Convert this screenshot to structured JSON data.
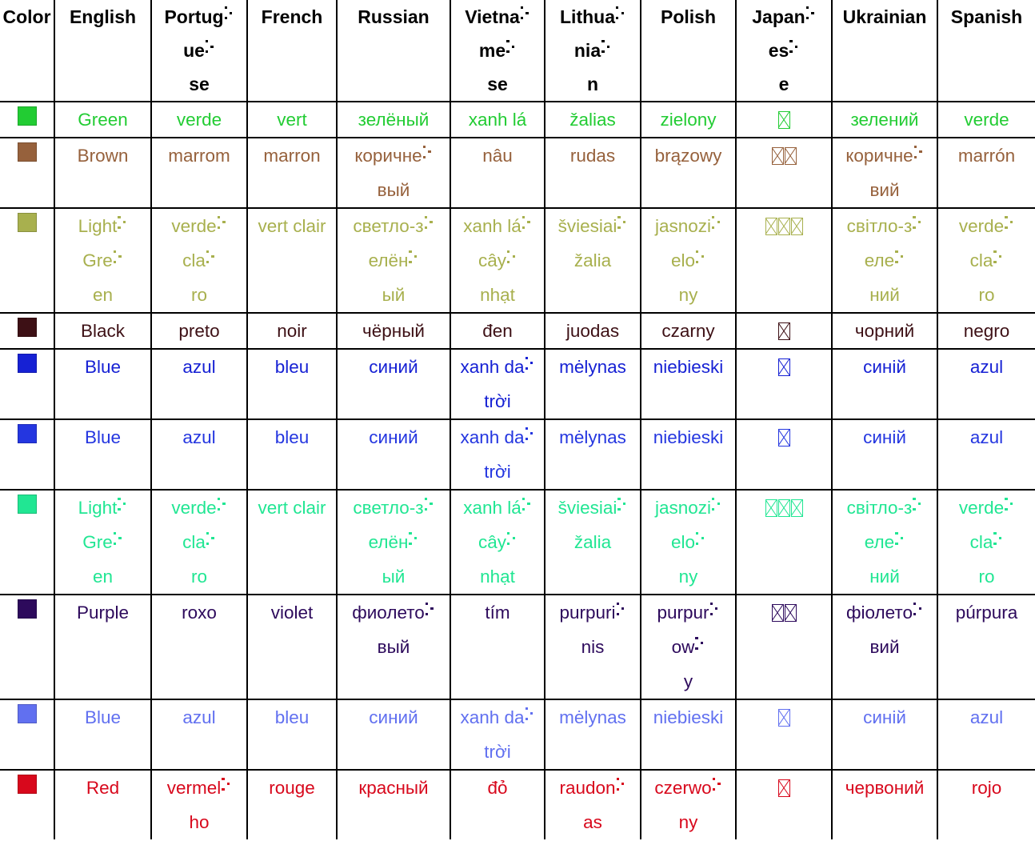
{
  "table": {
    "columns": [
      {
        "key": "color",
        "label": "Color"
      },
      {
        "key": "english",
        "label": "English"
      },
      {
        "key": "portuguese",
        "label": "Portuguese"
      },
      {
        "key": "french",
        "label": "French"
      },
      {
        "key": "russian",
        "label": "Russian"
      },
      {
        "key": "vietnamese",
        "label": "Vietnamese"
      },
      {
        "key": "lithuanian",
        "label": "Lithuanian"
      },
      {
        "key": "polish",
        "label": "Polish"
      },
      {
        "key": "japanese",
        "label": "Japanese"
      },
      {
        "key": "ukrainian",
        "label": "Ukrainian"
      },
      {
        "key": "spanish",
        "label": "Spanish"
      }
    ],
    "rows": [
      {
        "swatch": "#22cc33",
        "text_color": "#22cc33",
        "english": "Green",
        "portuguese": "verde",
        "french": "vert",
        "russian": "зелёный",
        "vietnamese": "xanh lá",
        "lithuanian": "žalias",
        "polish": "zielony",
        "japanese": "緑",
        "japanese_tofu": 1,
        "ukrainian": "зелений",
        "spanish": "verde"
      },
      {
        "swatch": "#96613c",
        "text_color": "#96613c",
        "english": "Brown",
        "portuguese": "marrom",
        "french": "marron",
        "russian": "коричневый",
        "vietnamese": "nâu",
        "lithuanian": "rudas",
        "polish": "brązowy",
        "japanese": "茶色",
        "japanese_tofu": 2,
        "ukrainian": "коричневий",
        "spanish": "marrón"
      },
      {
        "swatch": "#a8b04e",
        "text_color": "#a8b04e",
        "english": "Light Green",
        "portuguese": "verde claro",
        "french": "vert clair",
        "russian": "светло-зелёный",
        "vietnamese": "xanh lá cây nhạt",
        "lithuanian": "šviesiai žalia",
        "polish": "jasnozielony",
        "japanese": "明るい緑",
        "japanese_tofu": 3,
        "ukrainian": "світло-зелений",
        "spanish": "verde claro"
      },
      {
        "swatch": "#3d1015",
        "text_color": "#3d1015",
        "english": "Black",
        "portuguese": "preto",
        "french": "noir",
        "russian": "чёрный",
        "vietnamese": "đen",
        "lithuanian": "juodas",
        "polish": "czarny",
        "japanese": "黒",
        "japanese_tofu": 1,
        "ukrainian": "чорний",
        "spanish": "negro"
      },
      {
        "swatch": "#1621d4",
        "text_color": "#1621d4",
        "english": "Blue",
        "portuguese": "azul",
        "french": "bleu",
        "russian": "синий",
        "vietnamese": "xanh da trời",
        "lithuanian": "mėlynas",
        "polish": "niebieski",
        "japanese": "青",
        "japanese_tofu": 1,
        "ukrainian": "синій",
        "spanish": "azul"
      },
      {
        "swatch": "#2436e0",
        "text_color": "#2436e0",
        "english": "Blue",
        "portuguese": "azul",
        "french": "bleu",
        "russian": "синий",
        "vietnamese": "xanh da trời",
        "lithuanian": "mėlynas",
        "polish": "niebieski",
        "japanese": "青",
        "japanese_tofu": 1,
        "ukrainian": "синій",
        "spanish": "azul"
      },
      {
        "swatch": "#21e693",
        "text_color": "#21e693",
        "english": "Light Green",
        "portuguese": "verde claro",
        "french": "vert clair",
        "russian": "светло-зелёный",
        "vietnamese": "xanh lá cây nhạt",
        "lithuanian": "šviesiai žalia",
        "polish": "jasnozielony",
        "japanese": "明るい緑",
        "japanese_tofu": 3,
        "ukrainian": "світло-зелений",
        "spanish": "verde claro"
      },
      {
        "swatch": "#2d0a5c",
        "text_color": "#2d0a5c",
        "english": "Purple",
        "portuguese": "roxo",
        "french": "violet",
        "russian": "фиолетовый",
        "vietnamese": "tím",
        "lithuanian": "purpurinis",
        "polish": "purpurowy",
        "japanese": "紫色",
        "japanese_tofu": 2,
        "ukrainian": "фіолетовий",
        "spanish": "púrpura"
      },
      {
        "swatch": "#6170f0",
        "text_color": "#6170f0",
        "english": "Blue",
        "portuguese": "azul",
        "french": "bleu",
        "russian": "синий",
        "vietnamese": "xanh da trời",
        "lithuanian": "mėlynas",
        "polish": "niebieski",
        "japanese": "青",
        "japanese_tofu": 1,
        "ukrainian": "синій",
        "spanish": "azul"
      },
      {
        "swatch": "#d8081c",
        "text_color": "#d8081c",
        "english": "Red",
        "portuguese": "vermelho",
        "french": "rouge",
        "russian": "красный",
        "vietnamese": "đỏ",
        "lithuanian": "raudonas",
        "polish": "czerwony",
        "japanese": "赤",
        "japanese_tofu": 1,
        "ukrainian": "червоний",
        "spanish": "rojo"
      }
    ]
  },
  "wrapping": {
    "header_breaks": {
      "Portuguese": [
        "Portug",
        "ue",
        "se"
      ],
      "Vietnamese": [
        "Vietna",
        "me",
        "se"
      ],
      "Lithuanian": [
        "Lithua",
        "nia",
        "n"
      ],
      "Japanese": [
        "Japan",
        "es",
        "e"
      ]
    },
    "cell_breaks": {
      "коричневый": [
        "коричне",
        "вый"
      ],
      "Light Green": [
        "Light",
        "Gre",
        "en"
      ],
      "verde claro": [
        "verde",
        "cla",
        "ro"
      ],
      "светло-зелёный": [
        "светло-з",
        "елён",
        "ый"
      ],
      "xanh lá cây nhạt": [
        "xanh lá",
        "cây",
        "nhạt"
      ],
      "šviesiai žalia": [
        "šviesiai",
        "žalia"
      ],
      "jasnozielony": [
        "jasnozi",
        "elo",
        "ny"
      ],
      "коричневий": [
        "коричне",
        "вий"
      ],
      "світло-зелений": [
        "світло-з",
        "еле",
        "ний"
      ],
      "xanh da trời": [
        "xanh da",
        "trời"
      ],
      "фиолетовый": [
        "фиолето",
        "вый"
      ],
      "purpurinis": [
        "purpuri",
        "nis"
      ],
      "purpurowy": [
        "purpur",
        "ow",
        "y"
      ],
      "фіолетовий": [
        "фіолето",
        "вий"
      ],
      "vermelho": [
        "vermel",
        "ho"
      ],
      "raudonas": [
        "raudon",
        "as"
      ],
      "czerwony": [
        "czerwo",
        "ny"
      ]
    },
    "hyphen_marker": "⸫"
  }
}
